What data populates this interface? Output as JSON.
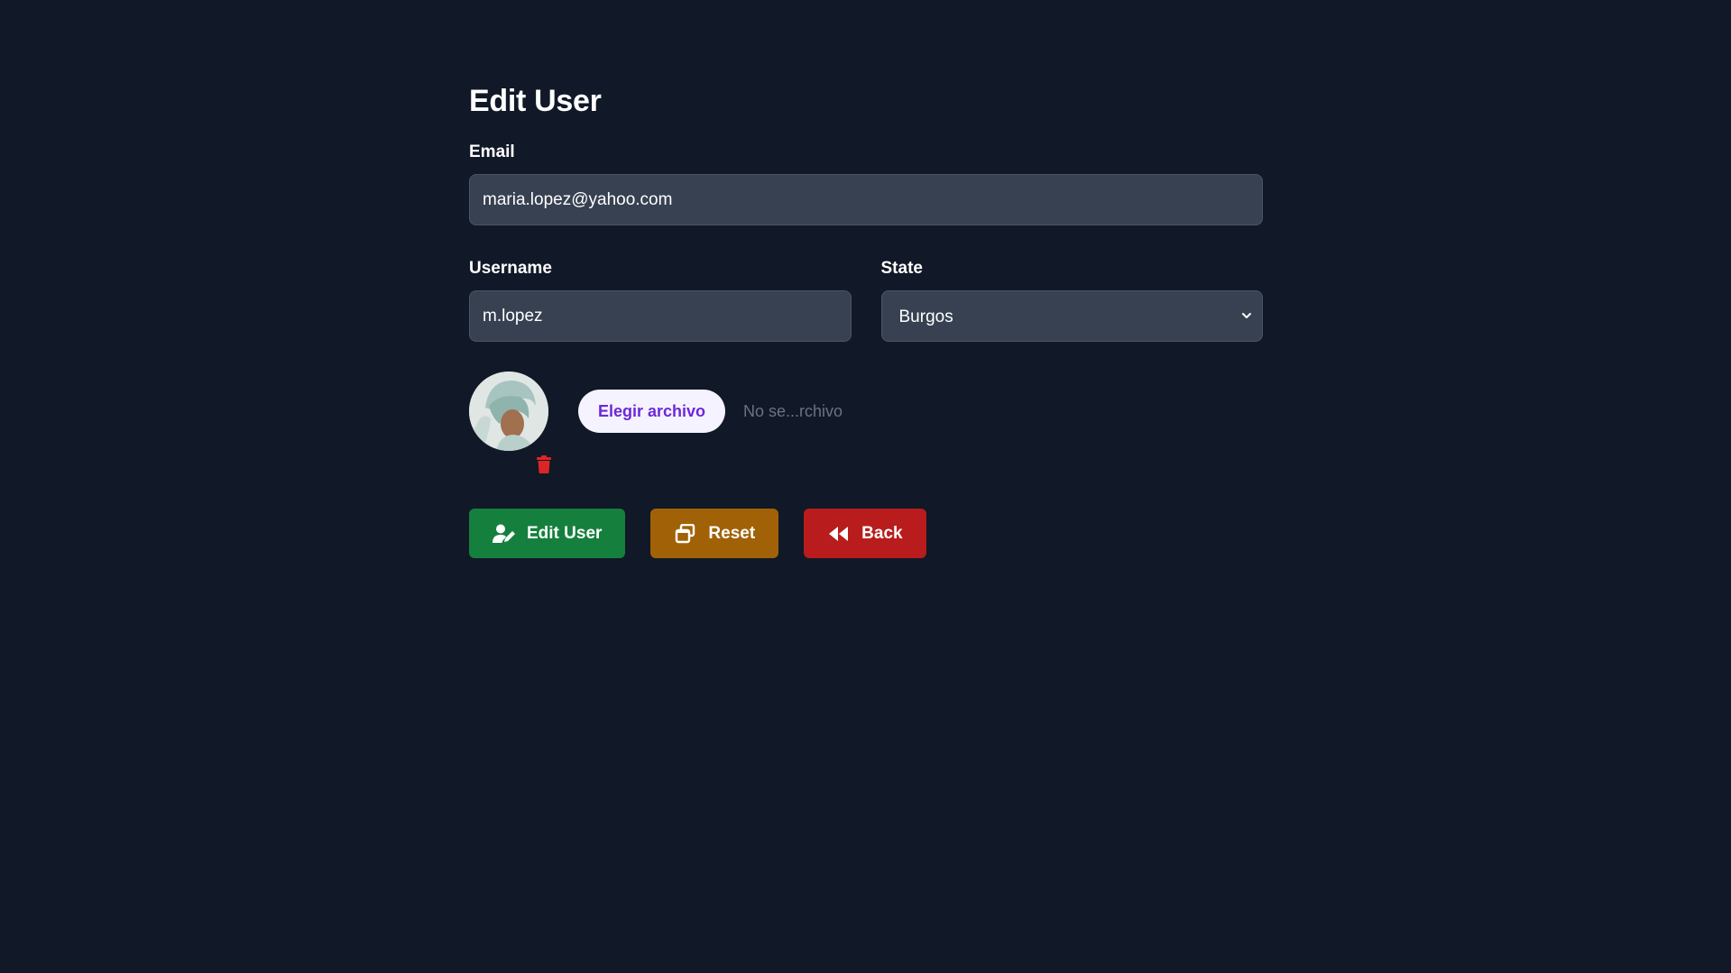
{
  "page": {
    "title": "Edit User"
  },
  "form": {
    "email": {
      "label": "Email",
      "value": "maria.lopez@yahoo.com"
    },
    "username": {
      "label": "Username",
      "value": "m.lopez"
    },
    "state": {
      "label": "State",
      "selected": "Burgos"
    },
    "avatar": {
      "file_button_label": "Elegir archivo",
      "file_status": "No se...rchivo"
    }
  },
  "actions": {
    "edit_label": "Edit User",
    "reset_label": "Reset",
    "back_label": "Back"
  },
  "icons": {
    "edit": "user-pen-icon",
    "reset": "window-restore-icon",
    "back": "backward-icon",
    "delete": "trash-icon",
    "select": "chevron-down-icon"
  },
  "colors": {
    "background": "#111827",
    "input_background": "#374151",
    "edit_button": "#15803d",
    "reset_button": "#a16207",
    "back_button": "#b91c1c",
    "file_button_text": "#6d28d9",
    "trash": "#dc2626"
  }
}
